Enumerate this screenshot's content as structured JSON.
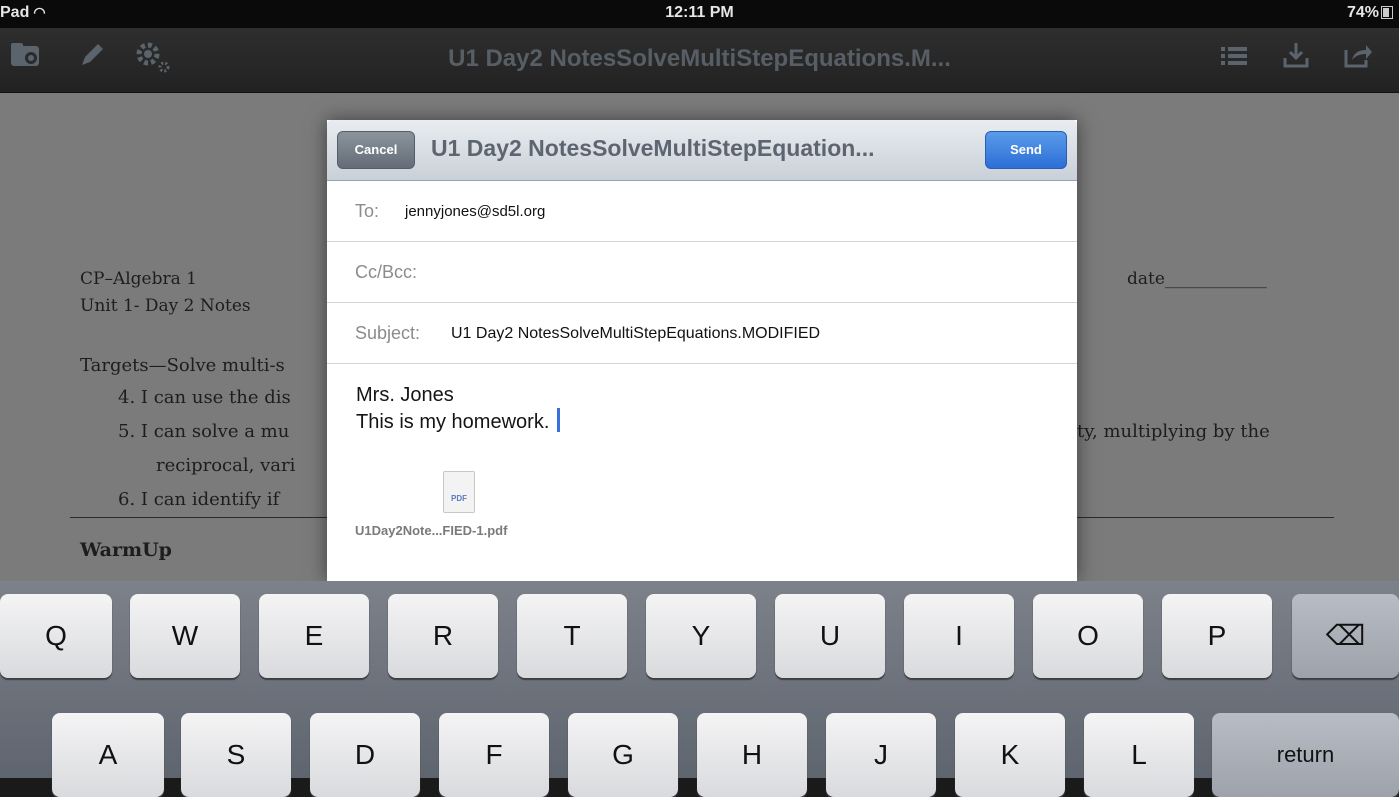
{
  "status_bar": {
    "device": "Pad",
    "time": "12:11 PM",
    "battery": "74%"
  },
  "toolbar": {
    "title": "U1 Day2 NotesSolveMultiStepEquations.M..."
  },
  "document": {
    "course": "CP–Algebra 1",
    "unit": "Unit 1- Day 2 Notes",
    "date_label": "date____________",
    "targets": "Targets—Solve multi-s",
    "item4": "4.   I can use the dis",
    "item5": "5.   I can solve a mu",
    "item5_end": "ty, multiplying by the",
    "item5_cont": "reciprocal, vari",
    "item6": "6.   I can identify if",
    "warmup": "WarmUp"
  },
  "compose": {
    "cancel_label": "Cancel",
    "title": "U1 Day2 NotesSolveMultiStepEquation...",
    "send_label": "Send",
    "to_label": "To:",
    "to_value": "jennyjones@sd5l.org",
    "ccbcc_label": "Cc/Bcc:",
    "subject_label": "Subject:",
    "subject_value": "U1 Day2 NotesSolveMultiStepEquations.MODIFIED",
    "body_line1": "Mrs. Jones",
    "body_line2": "This is my homework.",
    "attachment_icon_text": "PDF",
    "attachment_name": "U1Day2Note...FIED-1.pdf"
  },
  "keyboard": {
    "row1": [
      "Q",
      "W",
      "E",
      "R",
      "T",
      "Y",
      "U",
      "I",
      "O",
      "P"
    ],
    "row2": [
      "A",
      "S",
      "D",
      "F",
      "G",
      "H",
      "J",
      "K",
      "L"
    ],
    "return_label": "return",
    "delete_glyph": "⌫"
  }
}
